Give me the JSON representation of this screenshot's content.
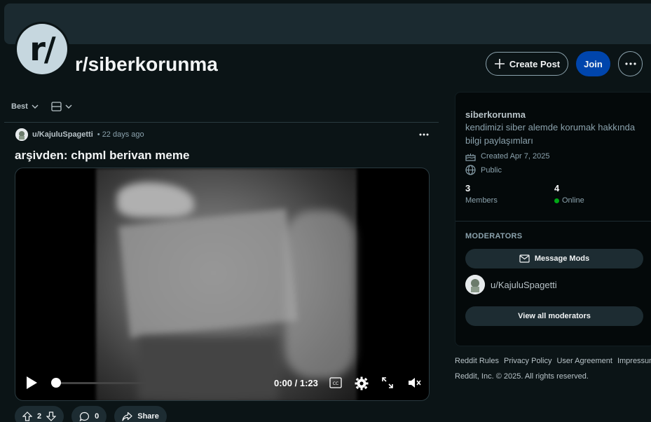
{
  "community": {
    "avatar_text": "r/",
    "name": "r/siberkorunma"
  },
  "header_actions": {
    "create_post": "Create Post",
    "join": "Join",
    "more_icon": "ellipsis-icon"
  },
  "sort": {
    "label": "Best",
    "view_icon": "layout-icon"
  },
  "post": {
    "author": "u/KajuluSpagetti",
    "time": "• 22 days ago",
    "title": "arşivden: chpml berivan meme",
    "video": {
      "time_display": "0:00 / 1:23",
      "progress": 0
    },
    "votes": "2",
    "comments": "0",
    "share": "Share"
  },
  "sidebar": {
    "name": "siberkorunma",
    "description": "kendimizi siber alemde korumak hakkında bilgi paylaşımları",
    "created": "Created Apr 7, 2025",
    "visibility": "Public",
    "members_count": "3",
    "members_label": "Members",
    "online_count": "4",
    "online_label": "Online",
    "moderators_heading": "MODERATORS",
    "message_mods": "Message Mods",
    "moderator": "u/KajuluSpagetti",
    "view_all_mods": "View all moderators"
  },
  "footer": {
    "links": [
      "Reddit Rules",
      "Privacy Policy",
      "User Agreement",
      "Impressum"
    ],
    "copyright": "Reddit, Inc. © 2025. All rights reserved."
  },
  "colors": {
    "background": "#0b1416",
    "join_button": "#0045ac",
    "online_dot": "#01a816"
  }
}
